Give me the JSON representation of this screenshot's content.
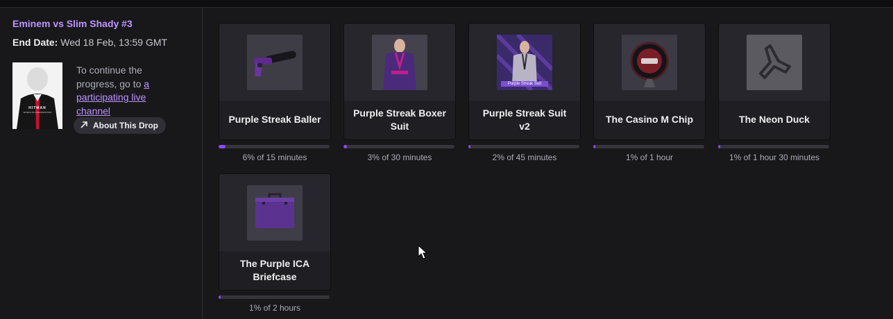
{
  "campaign": {
    "title": "Eminem vs Slim Shady #3",
    "end_date_label": "End Date:",
    "end_date_value": "Wed 18 Feb, 13:59 GMT",
    "info_text": "To continue the progress, go to ",
    "info_link": "a participating live channel",
    "about_button": "About This Drop",
    "cover_logo_text": "HITMAN",
    "cover_subtitle_text": "WORLD OF ASSASSINATION"
  },
  "drops": [
    {
      "name": "Purple Streak Baller",
      "progress_text": "6% of 15 minutes",
      "progress_pct": 6,
      "thumb": "pistol"
    },
    {
      "name": "Purple Streak Boxer Suit",
      "progress_text": "3% of 30 minutes",
      "progress_pct": 3,
      "thumb": "boxer"
    },
    {
      "name": "Purple Streak Suit v2",
      "progress_text": "2% of 45 minutes",
      "progress_pct": 2,
      "thumb": "suit",
      "thumb_caption": "Purple Streak Suit"
    },
    {
      "name": "The Casino M Chip",
      "progress_text": "1% of 1 hour",
      "progress_pct": 1,
      "thumb": "chip"
    },
    {
      "name": "The Neon Duck",
      "progress_text": "1% of 1 hour 30 minutes",
      "progress_pct": 1,
      "thumb": "duck"
    },
    {
      "name": "The Purple ICA Briefcase",
      "progress_text": "1% of 2 hours",
      "progress_pct": 1,
      "thumb": "briefcase"
    }
  ],
  "colors": {
    "accent": "#9147ff",
    "link": "#bf94ff",
    "background": "#18181b"
  }
}
